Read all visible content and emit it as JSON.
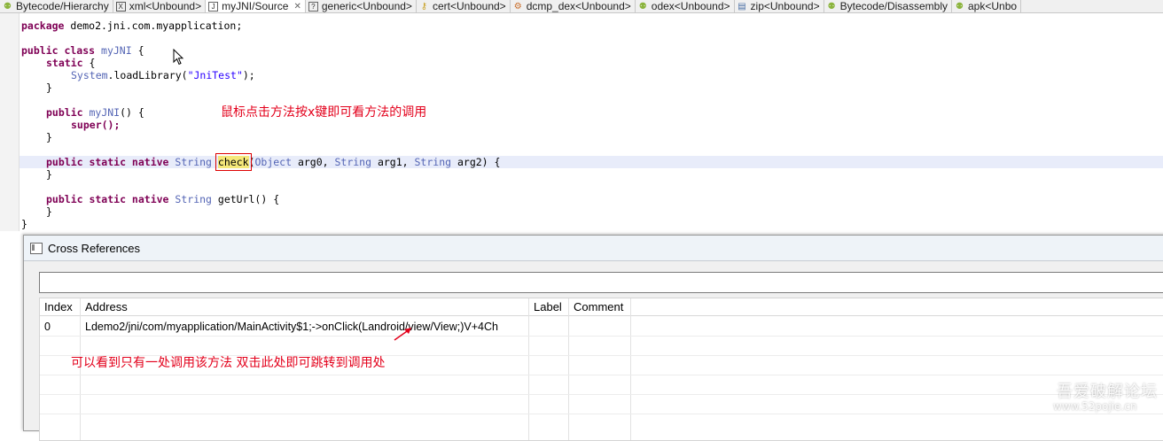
{
  "tabs": [
    {
      "label": "Bytecode/Hierarchy",
      "icon": "android-icon",
      "active": false
    },
    {
      "label": "xml<Unbound>",
      "icon": "xml-icon",
      "active": false
    },
    {
      "label": "myJNI/Source",
      "icon": "java-source-icon",
      "active": true
    },
    {
      "label": "generic<Unbound>",
      "icon": "generic-icon",
      "active": false
    },
    {
      "label": "cert<Unbound>",
      "icon": "key-icon",
      "active": false
    },
    {
      "label": "dcmp_dex<Unbound>",
      "icon": "gear-icon",
      "active": false
    },
    {
      "label": "odex<Unbound>",
      "icon": "android-icon",
      "active": false
    },
    {
      "label": "zip<Unbound>",
      "icon": "zip-icon",
      "active": false
    },
    {
      "label": "Bytecode/Disassembly",
      "icon": "android-icon",
      "active": false
    },
    {
      "label": "apk<Unbo",
      "icon": "android-icon",
      "active": false
    }
  ],
  "code": {
    "package_kw": "package",
    "package_name": " demo2.jni.com.myapplication;",
    "kw_public_class": "public class",
    "class_name": " myJNI",
    "open_brace": " {",
    "kw_static": "static",
    "system": "System",
    "load_call": ".loadLibrary(",
    "lib_string": "\"JniTest\"",
    "load_end": ");",
    "close_brace": "}",
    "kw_public": "public",
    "ctor_name": " myJNI",
    "ctor_rest": "() {",
    "super_call": "super();",
    "kw_public_static_native": "public static native",
    "type_string": "String",
    "method_check": "check",
    "paren_open": "(",
    "type_object": "Object",
    "arg0": " arg0, ",
    "arg1": " arg1, ",
    "arg2": " arg2) {",
    "method_geturl": " getUrl() {"
  },
  "annotations": {
    "editor_note": "鼠标点击方法按x键即可看方法的调用",
    "xref_note": "可以看到只有一处调用该方法 双击此处即可跳转到调用处"
  },
  "xref_window": {
    "title": "Cross References",
    "filter_value": "",
    "columns": [
      "Index",
      "Address",
      "Label",
      "Comment"
    ],
    "rows": [
      {
        "index": "0",
        "address": "Ldemo2/jni/com/myapplication/MainActivity$1;->onClick(Landroid/view/View;)V+4Ch",
        "label": "",
        "comment": ""
      }
    ]
  },
  "watermark": {
    "line1": "吾爱破解论坛",
    "line2": "www.52pojie.cn"
  },
  "colors": {
    "keyword": "#7f0055",
    "type": "#5465b5",
    "string": "#2a00ff",
    "annotation": "#e3001b",
    "current_line": "#e8ecfa"
  }
}
